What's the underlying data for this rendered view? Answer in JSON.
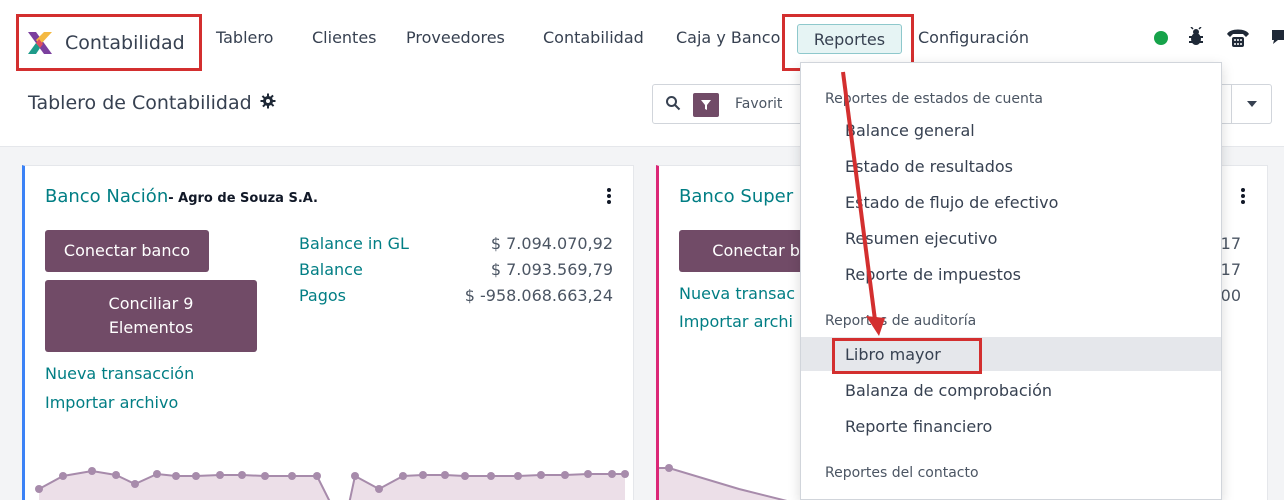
{
  "navbar": {
    "app_name": "Contabilidad",
    "items": [
      {
        "label": "Tablero"
      },
      {
        "label": "Clientes"
      },
      {
        "label": "Proveedores"
      },
      {
        "label": "Contabilidad"
      },
      {
        "label": "Caja y Banco"
      },
      {
        "label": "Reportes"
      },
      {
        "label": "Configuración"
      }
    ],
    "status_color": "#16a34a",
    "icons": [
      "status-dot",
      "bug-icon",
      "phone-icon",
      "chat-icon"
    ]
  },
  "control": {
    "breadcrumb": "Tablero de Contabilidad",
    "search_filter": "Favorit"
  },
  "cards": [
    {
      "title": "Banco Nación",
      "company": "- Agro de Souza S.A.",
      "buttons": [
        "Conectar banco",
        "Conciliar 9 Elementos"
      ],
      "links": [
        "Nueva transacción",
        "Importar archivo"
      ],
      "stats": [
        {
          "label": "Balance in GL",
          "value": "$ 7.094.070,92"
        },
        {
          "label": "Balance",
          "value": "$ 7.093.569,79"
        },
        {
          "label": "Pagos",
          "value": "$ -958.068.663,24"
        }
      ],
      "accent": "#3b82f6"
    },
    {
      "title": "Banco Super",
      "buttons": [
        "Conectar ba"
      ],
      "links": [
        "Nueva transac",
        "Importar archi"
      ],
      "values": [
        "17",
        "17",
        "00"
      ],
      "accent": "#db2777"
    }
  ],
  "dropdown": {
    "sections": [
      {
        "header": "Reportes de estados de cuenta",
        "items": [
          "Balance general",
          "Estado de resultados",
          "Estado de flujo de efectivo",
          "Resumen ejecutivo",
          "Reporte de impuestos"
        ]
      },
      {
        "header": "Reportes de auditoría",
        "items": [
          "Libro mayor",
          "Balanza de comprobación",
          "Reporte financiero"
        ]
      },
      {
        "header": "Reportes del contacto",
        "items": []
      }
    ],
    "active_item": "Libro mayor"
  },
  "colors": {
    "brand": "#714b67",
    "link": "#017e84",
    "annotation": "#d32f2f"
  }
}
